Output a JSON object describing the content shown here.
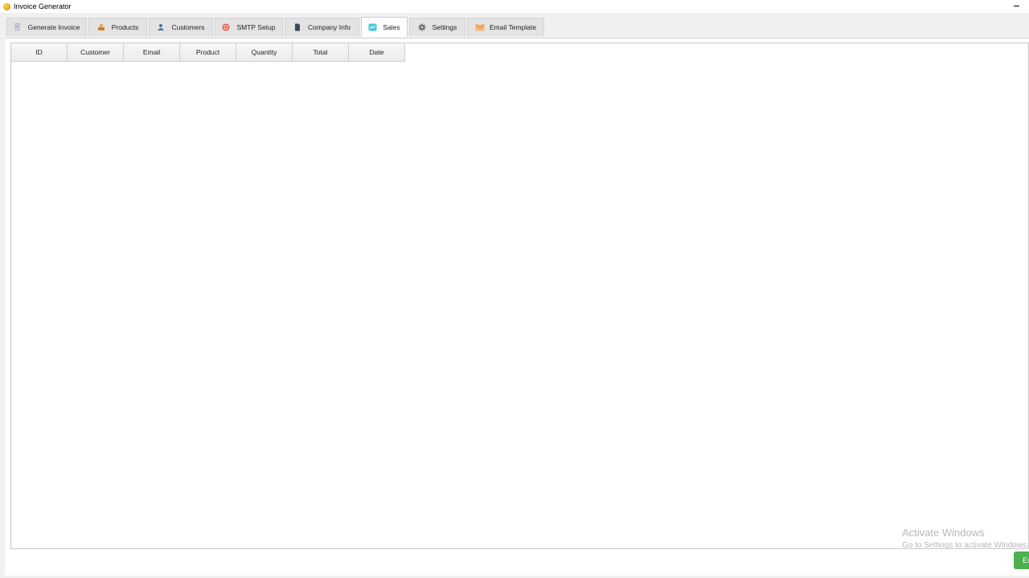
{
  "window": {
    "title": "Invoice Generator"
  },
  "tabs": [
    {
      "label": "Generate Invoice",
      "icon": "document-icon"
    },
    {
      "label": "Products",
      "icon": "boxes-icon"
    },
    {
      "label": "Customers",
      "icon": "users-icon"
    },
    {
      "label": "SMTP Setup",
      "icon": "email-server-icon"
    },
    {
      "label": "Company Info",
      "icon": "file-icon"
    },
    {
      "label": "Sales",
      "icon": "chart-icon",
      "active": true
    },
    {
      "label": "Settings",
      "icon": "gear-icon"
    },
    {
      "label": "Email Template",
      "icon": "envelope-icon"
    }
  ],
  "sales_table": {
    "columns": [
      "ID",
      "Customer",
      "Email",
      "Product",
      "Quantity",
      "Total",
      "Date"
    ],
    "rows": []
  },
  "watermark": {
    "title": "Activate Windows",
    "subtitle": "Go to Settings to activate Windows."
  },
  "export_button": {
    "label": "Ex"
  },
  "colors": {
    "accent_green": "#4caf50",
    "active_tab_bg": "#ffffff",
    "inactive_tab_bg": "#e3e3e3"
  }
}
